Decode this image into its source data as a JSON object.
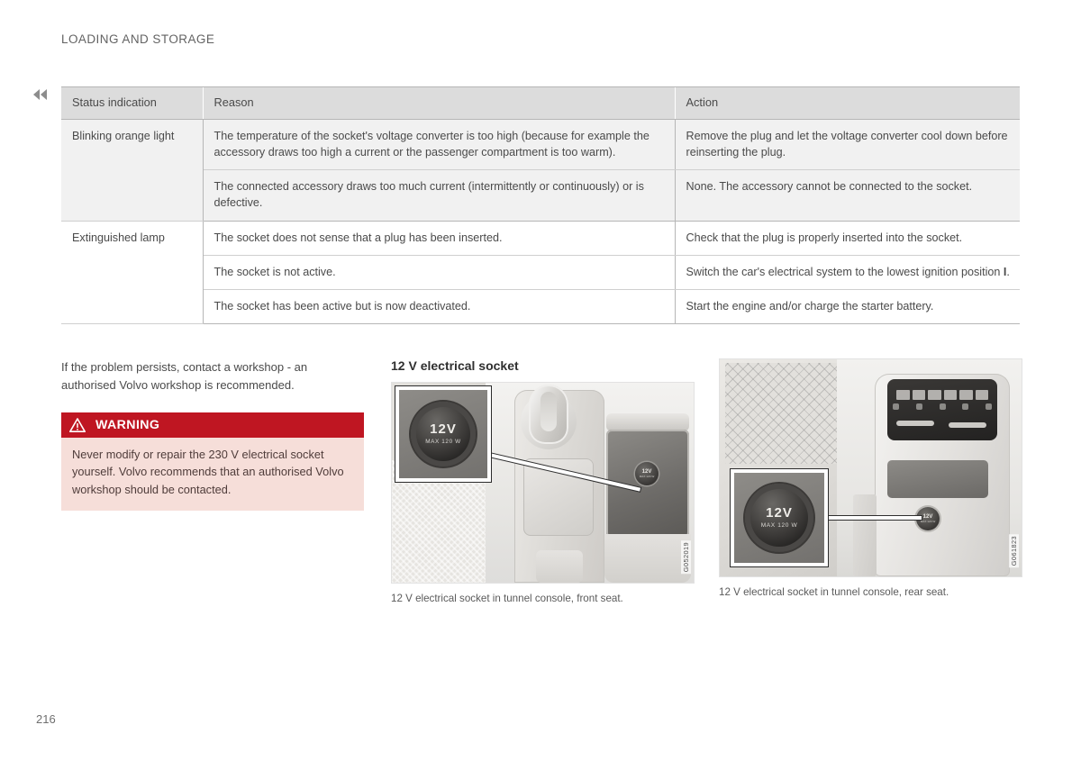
{
  "page": {
    "running_header": "LOADING AND STORAGE",
    "page_number": "216",
    "nav_icon": "double-chevron-left-icon"
  },
  "table": {
    "columns": [
      "Status indication",
      "Reason",
      "Action"
    ],
    "rows": [
      {
        "status": "Blinking orange light",
        "rowspan": 2,
        "shaded": true,
        "entries": [
          {
            "reason": "The temperature of the socket's voltage converter is too high (because for example the accessory draws too high a current or the passenger compartment is too warm).",
            "action": "Remove the plug and let the voltage converter cool down before reinserting the plug."
          },
          {
            "reason": "The connected accessory draws too much current (intermittently or continuously) or is defective.",
            "action": "None. The accessory cannot be connected to the socket."
          }
        ]
      },
      {
        "status": "Extinguished lamp",
        "rowspan": 3,
        "shaded": false,
        "entries": [
          {
            "reason": "The socket does not sense that a plug has been inserted.",
            "action": "Check that the plug is properly inserted into the socket."
          },
          {
            "reason": "The socket is not active.",
            "action_prefix": "Switch the car's electrical system to the lowest ignition position ",
            "action_bold": "I",
            "action_suffix": "."
          },
          {
            "reason": "The socket has been active but is now deactivated.",
            "action": "Start the engine and/or charge the starter battery."
          }
        ]
      }
    ]
  },
  "body": {
    "paragraph": "If the problem persists, contact a workshop - an authorised Volvo workshop is recommended."
  },
  "warning": {
    "icon": "warning-triangle-icon",
    "title": "WARNING",
    "text": "Never modify or repair the 230 V electrical socket yourself. Volvo recommends that an authorised Volvo workshop should be contacted.",
    "header_color": "#bf1622",
    "body_color": "#f6ded9"
  },
  "figures": {
    "section_title": "12 V electrical socket",
    "front": {
      "caption": "12 V electrical socket in tunnel console, front seat.",
      "image_code": "G052019",
      "socket_label_volts": "12V",
      "socket_label_max": "MAX 120 W"
    },
    "rear": {
      "caption": "12 V electrical socket in tunnel console, rear seat.",
      "image_code": "G061823",
      "socket_label_volts": "12V",
      "socket_label_max": "MAX 120 W"
    }
  }
}
